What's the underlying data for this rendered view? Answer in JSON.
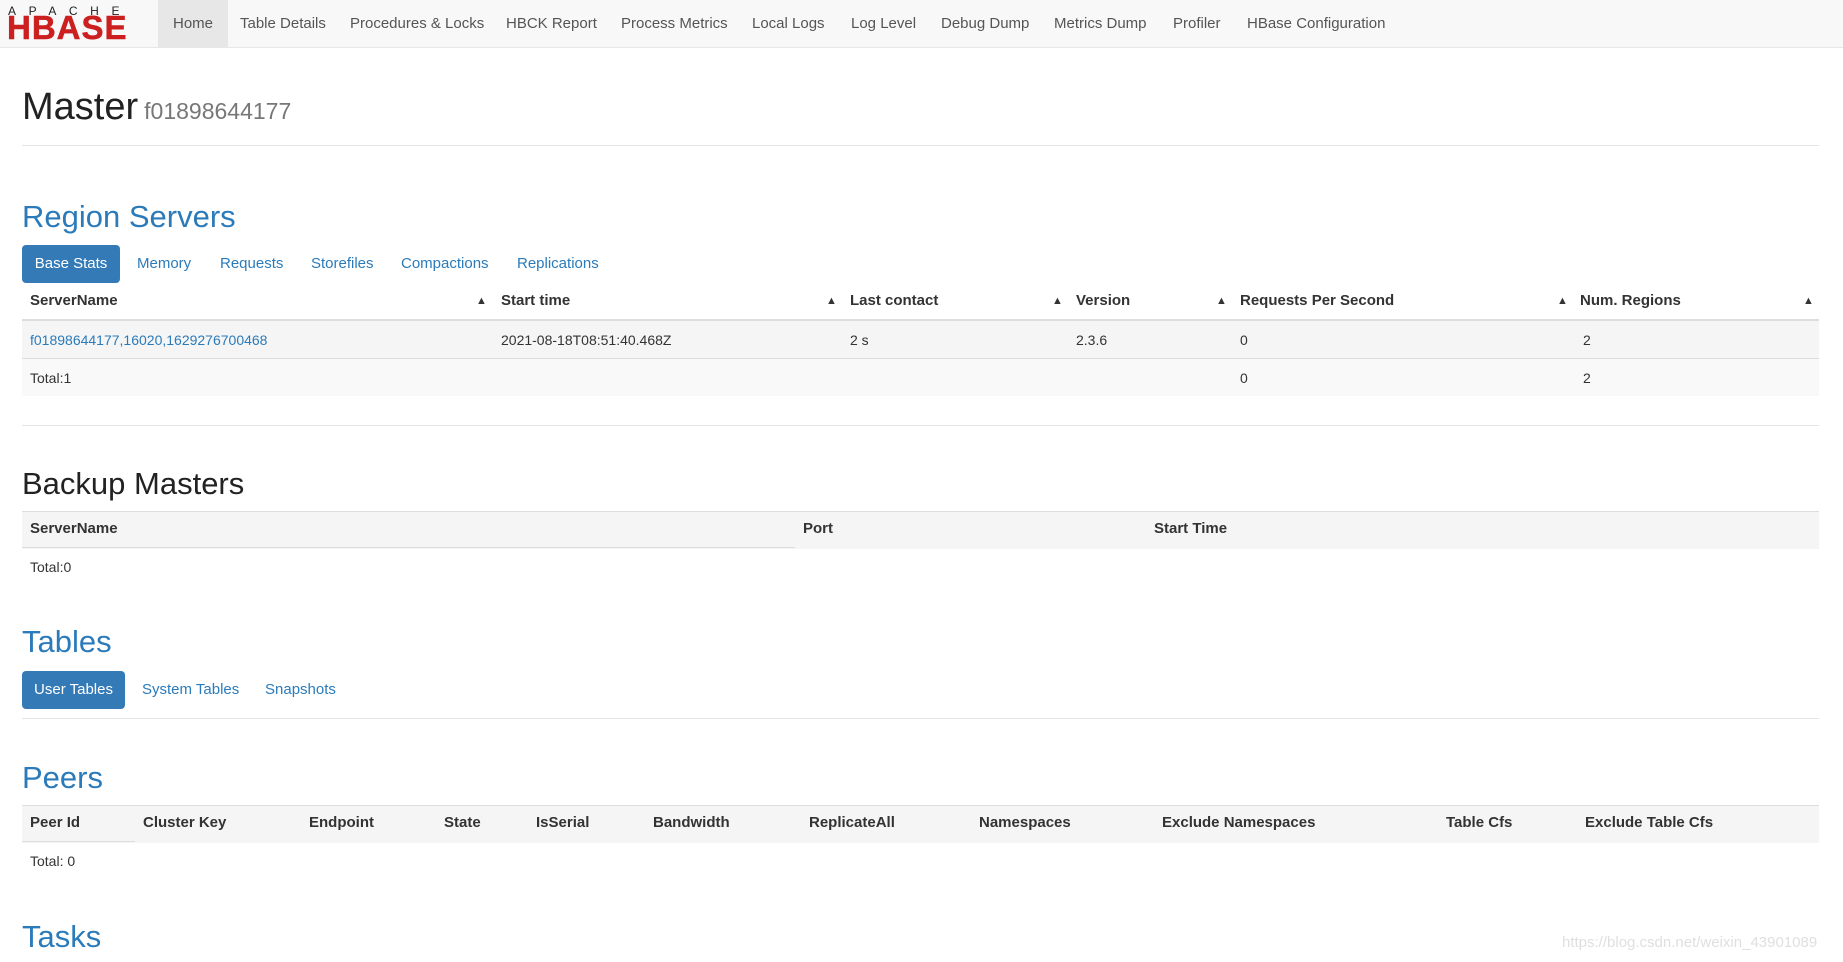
{
  "brand": {
    "top": "APACHE",
    "main": "HBASE",
    "color": "#cc1f1f"
  },
  "nav": {
    "items": [
      {
        "label": "Home",
        "active": true
      },
      {
        "label": "Table Details"
      },
      {
        "label": "Procedures & Locks"
      },
      {
        "label": "HBCK Report"
      },
      {
        "label": "Process Metrics"
      },
      {
        "label": "Local Logs"
      },
      {
        "label": "Log Level"
      },
      {
        "label": "Debug Dump"
      },
      {
        "label": "Metrics Dump"
      },
      {
        "label": "Profiler"
      },
      {
        "label": "HBase Configuration"
      }
    ]
  },
  "page": {
    "title": "Master",
    "host": "f01898644177"
  },
  "region_servers": {
    "heading": "Region Servers",
    "tabs": [
      "Base Stats",
      "Memory",
      "Requests",
      "Storefiles",
      "Compactions",
      "Replications"
    ],
    "columns": [
      "ServerName",
      "Start time",
      "Last contact",
      "Version",
      "Requests Per Second",
      "Num. Regions"
    ],
    "row": [
      "f01898644177,16020,1629276700468",
      "2021-08-18T08:51:40.468Z",
      "2 s",
      "2.3.6",
      "0",
      "2"
    ],
    "total": {
      "label": "Total:1",
      "rps": "0",
      "regions": "2"
    }
  },
  "backup_masters": {
    "heading": "Backup Masters",
    "columns": [
      "ServerName",
      "Port",
      "Start Time"
    ],
    "total": "Total:0"
  },
  "tables": {
    "heading": "Tables",
    "tabs": [
      "User Tables",
      "System Tables",
      "Snapshots"
    ]
  },
  "peers": {
    "heading": "Peers",
    "columns": [
      "Peer Id",
      "Cluster Key",
      "Endpoint",
      "State",
      "IsSerial",
      "Bandwidth",
      "ReplicateAll",
      "Namespaces",
      "Exclude Namespaces",
      "Table Cfs",
      "Exclude Table Cfs"
    ],
    "total": "Total: 0"
  },
  "tasks": {
    "heading": "Tasks"
  },
  "watermark": "https://blog.csdn.net/weixin_43901089",
  "colors": {
    "accent": "#2b7bba",
    "active_pill": "#337ab7",
    "stripe": "#f5f5f5"
  }
}
